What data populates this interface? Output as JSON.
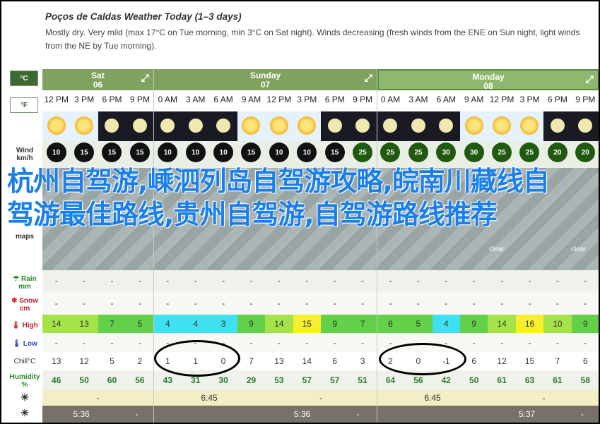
{
  "header": {
    "title": "Poços de Caldas Weather Today (1–3 days)",
    "description": "Mostly dry. Very mild (max 17°C on Tue morning, min 3°C on Sat night). Winds decreasing (fresh winds from the ENE on Sun night, light winds from the NE by Tue morning)."
  },
  "units": {
    "celsius": "°C",
    "fahrenheit": "°F"
  },
  "days": [
    {
      "name": "Sat",
      "date": "06"
    },
    {
      "name": "Sunday",
      "date": "07"
    },
    {
      "name": "Monday",
      "date": "08"
    }
  ],
  "times": [
    "12 PM",
    "3 PM",
    "6 PM",
    "9 PM",
    "0 AM",
    "3 AM",
    "6 AM",
    "9 AM",
    "12 PM",
    "3 PM",
    "6 PM",
    "9 PM",
    "0 AM",
    "3 AM",
    "6 AM",
    "9 AM",
    "12 PM",
    "3 PM",
    "6 PM",
    "9 PM"
  ],
  "sky": [
    "sun",
    "sun",
    "moon",
    "moon",
    "moon",
    "moon",
    "moon",
    "sun",
    "sun",
    "sun",
    "moon",
    "moon",
    "moon",
    "moon",
    "moon",
    "sun",
    "sun",
    "sun",
    "moon",
    "moon"
  ],
  "wind": [
    "10",
    "15",
    "15",
    "15",
    "10",
    "10",
    "10",
    "15",
    "10",
    "10",
    "15",
    "25",
    "25",
    "25",
    "30",
    "30",
    "25",
    "25",
    "20",
    "20"
  ],
  "wind_green": [
    false,
    false,
    false,
    false,
    false,
    false,
    false,
    false,
    false,
    false,
    false,
    true,
    true,
    true,
    true,
    true,
    true,
    true,
    true,
    true
  ],
  "labels": {
    "wind": "Wind km/h",
    "maps": "maps",
    "rain": "Rain mm",
    "snow": "Snow cm",
    "high": "High",
    "low": "Low",
    "chill": "Chill°C",
    "humidity": "Humidity %"
  },
  "clear_labels": [
    "clear",
    "clear"
  ],
  "rain": [
    "-",
    "-",
    "-",
    "-",
    "-",
    "-",
    "-",
    "-",
    "-",
    "-",
    "-",
    "-",
    "-",
    "-",
    "-",
    "-",
    "-",
    "-",
    "-",
    "-"
  ],
  "snow": [
    "-",
    "-",
    "-",
    "-",
    "-",
    "-",
    "-",
    "-",
    "-",
    "-",
    "-",
    "-",
    "-",
    "-",
    "-",
    "-",
    "-",
    "-",
    "-",
    "-"
  ],
  "high": [
    "14",
    "13",
    "7",
    "5",
    "4",
    "4",
    "3",
    "9",
    "14",
    "15",
    "9",
    "7",
    "6",
    "5",
    "4",
    "9",
    "14",
    "16",
    "10",
    "9"
  ],
  "high_colors": [
    "#a6e34a",
    "#a6e34a",
    "#63d04a",
    "#63d04a",
    "#3fe0f0",
    "#3fe0f0",
    "#3fe0f0",
    "#63d04a",
    "#a6e34a",
    "#f6ef2d",
    "#63d04a",
    "#63d04a",
    "#63d04a",
    "#63d04a",
    "#3fe0f0",
    "#63d04a",
    "#a6e34a",
    "#f6ef2d",
    "#a6e34a",
    "#63d04a"
  ],
  "low": [
    "-",
    "-",
    "-",
    "-",
    "-",
    "-",
    "-",
    "-",
    "-",
    "-",
    "-",
    "-",
    "-",
    "-",
    "-",
    "-",
    "-",
    "-",
    "-",
    "-"
  ],
  "chill": [
    "13",
    "12",
    "5",
    "2",
    "1",
    "1",
    "0",
    "7",
    "13",
    "14",
    "6",
    "3",
    "2",
    "0",
    "-1",
    "6",
    "12",
    "15",
    "7",
    "6"
  ],
  "humidity": [
    "46",
    "50",
    "60",
    "56",
    "43",
    "31",
    "30",
    "29",
    "53",
    "57",
    "57",
    "51",
    "64",
    "56",
    "42",
    "50",
    "61",
    "63",
    "61",
    "58"
  ],
  "sunrise": [
    "-",
    "6:45",
    "-",
    "6:45",
    "-"
  ],
  "sunset": [
    "5:36",
    "-",
    "5:36",
    "-",
    "5:37",
    "-"
  ],
  "overlay_text": "杭州自驾游,嵊泗列岛自驾游攻略,皖南川藏线自驾游最佳路线,贵州自驾游,自驾游路线推荐"
}
